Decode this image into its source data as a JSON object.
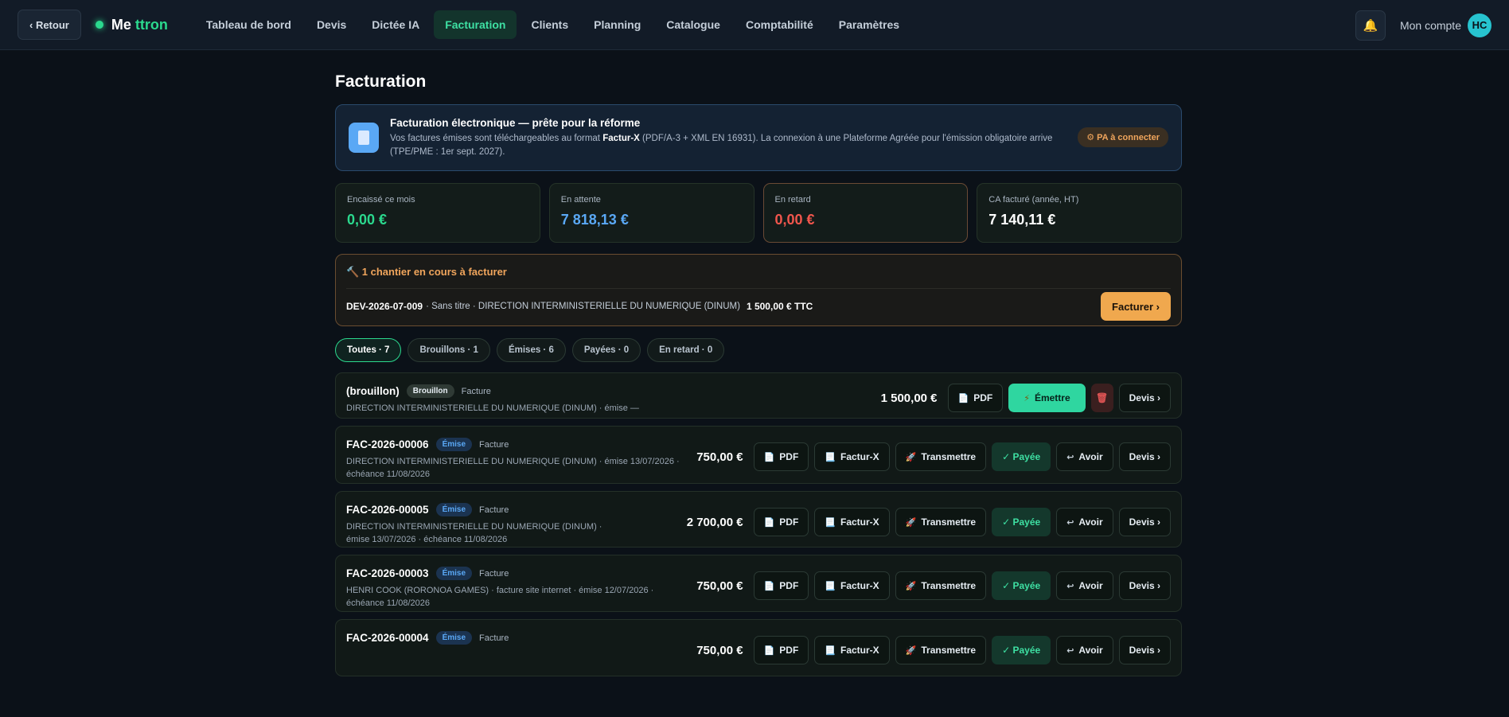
{
  "topbar": {
    "back_label": "‹ Retour",
    "brand_part1": "Me",
    "brand_part2": "ttron",
    "nav": [
      {
        "label": "Tableau de bord"
      },
      {
        "label": "Devis"
      },
      {
        "label": "Dictée IA"
      },
      {
        "label": "Facturation",
        "active": true
      },
      {
        "label": "Clients"
      },
      {
        "label": "Planning"
      },
      {
        "label": "Catalogue"
      },
      {
        "label": "Comptabilité"
      },
      {
        "label": "Paramètres"
      }
    ],
    "account_label": "Mon compte",
    "avatar_initials": "HC"
  },
  "page": {
    "title": "Facturation"
  },
  "efacturation": {
    "title": "Facturation électronique — prête pour la réforme",
    "text_before": "Vos factures émises sont téléchargeables au format ",
    "text_bold": "Factur-X",
    "text_after": " (PDF/A-3 + XML EN 16931). La connexion à une Plateforme Agréée pour l'émission obligatoire arrive (TPE/PME : 1er sept. 2027).",
    "badge": "⚙ PA à connecter"
  },
  "stats": [
    {
      "label": "Encaissé ce mois",
      "value": "0,00 €",
      "color": "#2bd98e"
    },
    {
      "label": "En attente",
      "value": "7 818,13 €",
      "color": "#5aa8f5"
    },
    {
      "label": "En retard",
      "value": "0,00 €",
      "color": "#f0564d"
    },
    {
      "label": "CA facturé (année, HT)",
      "value": "7 140,11 €",
      "color": "#ffffff"
    }
  ],
  "chantier": {
    "heading": "🔨 1 chantier en cours à facturer",
    "ref": "DEV-2026-07-009",
    "desc": "· Sans titre · DIRECTION INTERMINISTERIELLE DU NUMERIQUE (DINUM)",
    "amount": "1 500,00 € TTC",
    "button": "Facturer ›"
  },
  "filters": [
    {
      "label": "Toutes · 7",
      "active": true
    },
    {
      "label": "Brouillons · 1"
    },
    {
      "label": "Émises · 6"
    },
    {
      "label": "Payées · 0"
    },
    {
      "label": "En retard · 0"
    }
  ],
  "labels": {
    "pdf": "PDF",
    "facturx": "Factur-X",
    "transmettre": "Transmettre",
    "payee": "✓ Payée",
    "avoir": "Avoir",
    "devis": "Devis ›",
    "emettre": "Émettre"
  },
  "invoices": [
    {
      "ref": "(brouillon)",
      "status": "Brouillon",
      "kind": "Facture",
      "sub": "DIRECTION INTERMINISTERIELLE DU NUMERIQUE (DINUM) · émise —",
      "amount": "1 500,00 €",
      "draft": true
    },
    {
      "ref": "FAC-2026-00006",
      "status": "Émise",
      "kind": "Facture",
      "sub": "DIRECTION INTERMINISTERIELLE DU NUMERIQUE (DINUM) · émise 13/07/2026 · échéance 11/08/2026",
      "amount": "750,00 €"
    },
    {
      "ref": "FAC-2026-00005",
      "status": "Émise",
      "kind": "Facture",
      "sub": "DIRECTION INTERMINISTERIELLE DU NUMERIQUE (DINUM) · émise 13/07/2026 · échéance 11/08/2026",
      "amount": "2 700,00 €"
    },
    {
      "ref": "FAC-2026-00003",
      "status": "Émise",
      "kind": "Facture",
      "sub": "HENRI COOK (RORONOA GAMES) · facture site internet · émise 12/07/2026 · échéance 11/08/2026",
      "amount": "750,00 €"
    },
    {
      "ref": "FAC-2026-00004",
      "status": "Émise",
      "kind": "Facture",
      "sub": "",
      "amount": "750,00 €"
    }
  ]
}
